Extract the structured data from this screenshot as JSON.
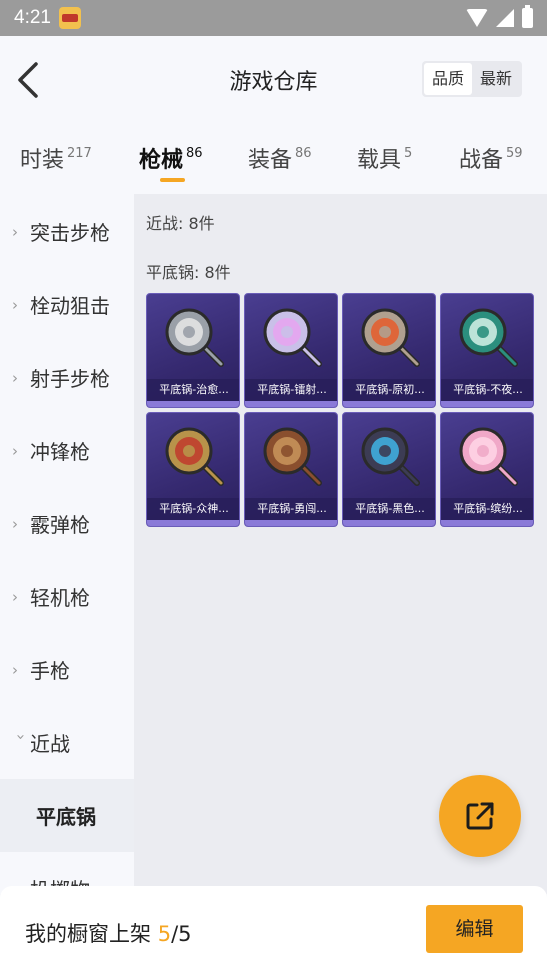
{
  "status_bar": {
    "time": "4:21"
  },
  "header": {
    "title": "游戏仓库",
    "sort_options": [
      "品质",
      "最新"
    ],
    "sort_active": "品质"
  },
  "tabs": [
    {
      "label": "时装",
      "count": "217"
    },
    {
      "label": "枪械",
      "count": "86"
    },
    {
      "label": "装备",
      "count": "86"
    },
    {
      "label": "载具",
      "count": "5"
    },
    {
      "label": "战备",
      "count": "59"
    }
  ],
  "sidebar": {
    "items": [
      {
        "label": "突击步枪",
        "expanded": false
      },
      {
        "label": "栓动狙击",
        "expanded": false
      },
      {
        "label": "射手步枪",
        "expanded": false
      },
      {
        "label": "冲锋枪",
        "expanded": false
      },
      {
        "label": "霰弹枪",
        "expanded": false
      },
      {
        "label": "轻机枪",
        "expanded": false
      },
      {
        "label": "手枪",
        "expanded": false
      },
      {
        "label": "近战",
        "expanded": true
      },
      {
        "label": "平底锅",
        "sub": true
      },
      {
        "label": "投掷物",
        "expanded": false
      }
    ]
  },
  "content": {
    "category_label": "近战: 8件",
    "subcategory_label": "平底锅: 8件",
    "items": [
      {
        "name": "平底锅-治愈...",
        "color": "#9aa0a8",
        "accent": "#e8e8e8"
      },
      {
        "name": "平底锅-镭射...",
        "color": "#c9c0e8",
        "accent": "#e7a3f0"
      },
      {
        "name": "平底锅-原初...",
        "color": "#b0a08f",
        "accent": "#e65c2b"
      },
      {
        "name": "平底锅-不夜...",
        "color": "#2b8f7e",
        "accent": "#d6f2e8"
      },
      {
        "name": "平底锅-众神...",
        "color": "#b8934a",
        "accent": "#c0392b"
      },
      {
        "name": "平底锅-勇闯...",
        "color": "#8a4f2e",
        "accent": "#c9955c"
      },
      {
        "name": "平底锅-黑色...",
        "color": "#3c3c54",
        "accent": "#3fb4e6"
      },
      {
        "name": "平底锅-缤纷...",
        "color": "#f0a8c8",
        "accent": "#ffd6e6"
      }
    ]
  },
  "bottom_bar": {
    "label": "我的橱窗上架",
    "current": "5",
    "separator": "/",
    "total": "5",
    "edit_label": "编辑"
  },
  "colors": {
    "accent": "#f5a623",
    "card_bg": "#3a2f7a"
  }
}
